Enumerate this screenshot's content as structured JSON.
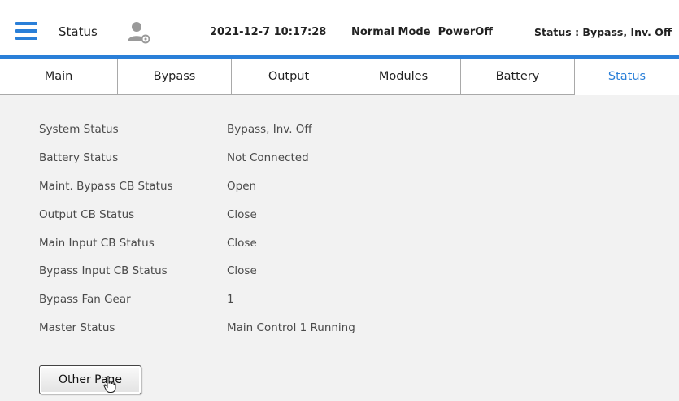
{
  "header": {
    "title": "Status",
    "datetime": "2021-12-7 10:17:28",
    "mode": "Normal Mode  PowerOff",
    "status": "Status : Bypass, Inv. Off",
    "icons": [
      "menu-icon",
      "user-settings-icon"
    ]
  },
  "tabs": [
    {
      "label": "Main",
      "active": false
    },
    {
      "label": "Bypass",
      "active": false
    },
    {
      "label": "Output",
      "active": false
    },
    {
      "label": "Modules",
      "active": false
    },
    {
      "label": "Battery",
      "active": false
    },
    {
      "label": "Status",
      "active": true
    }
  ],
  "status_rows": [
    {
      "label": "System Status",
      "value": "Bypass, Inv. Off"
    },
    {
      "label": "Battery Status",
      "value": "Not Connected"
    },
    {
      "label": "Maint. Bypass CB Status",
      "value": "Open"
    },
    {
      "label": "Output CB Status",
      "value": "Close"
    },
    {
      "label": "Main Input CB Status",
      "value": "Close"
    },
    {
      "label": "Bypass Input CB Status",
      "value": "Close"
    },
    {
      "label": "Bypass Fan Gear",
      "value": "1"
    },
    {
      "label": "Master Status",
      "value": "Main Control 1 Running"
    }
  ],
  "buttons": {
    "other_page": "Other Page"
  },
  "colors": {
    "accent": "#2a7fd8",
    "content_bg": "#f2f2f2",
    "label_text": "#4a4a4a"
  }
}
